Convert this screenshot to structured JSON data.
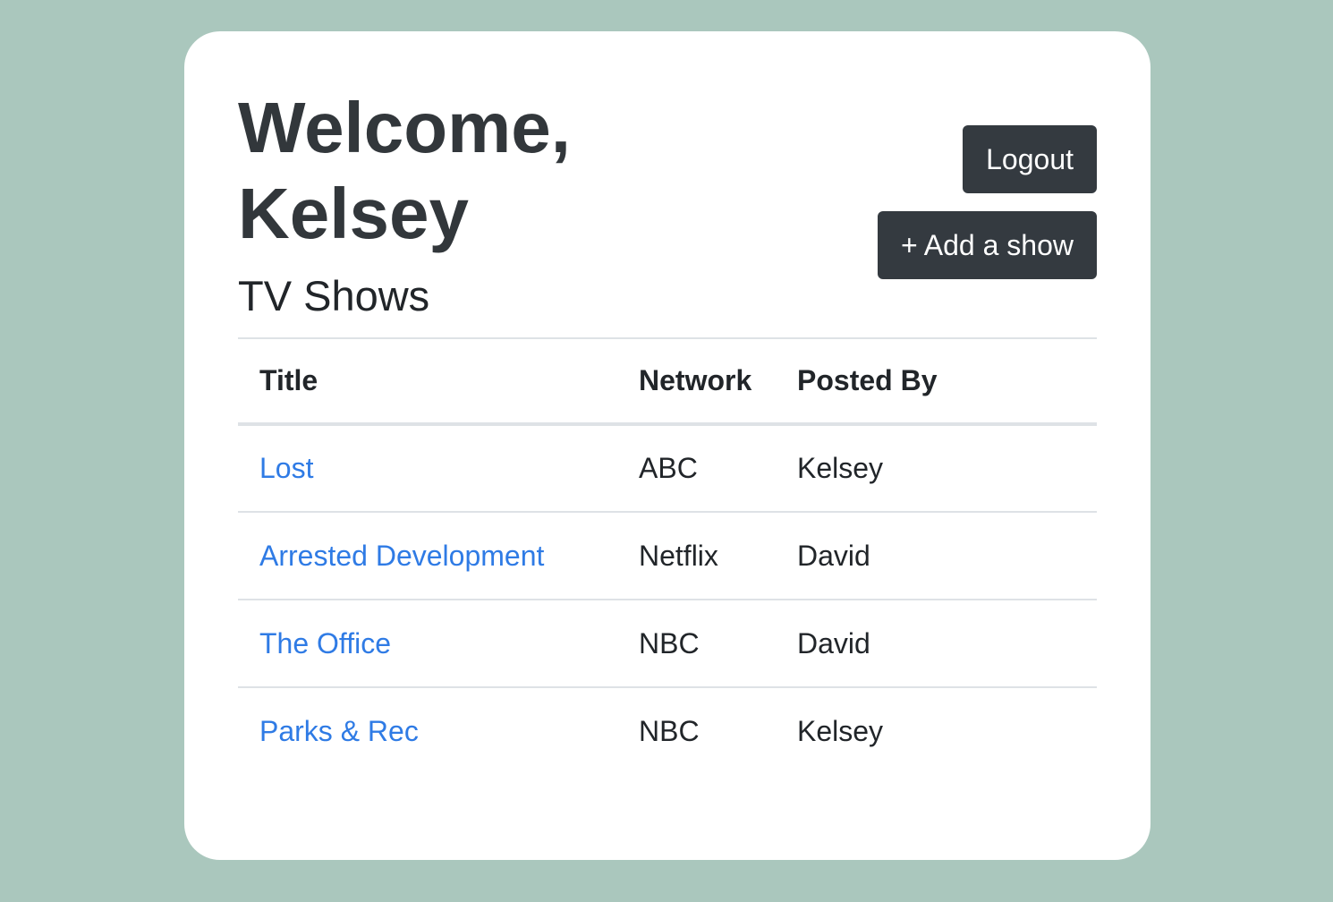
{
  "header": {
    "welcome_line1": "Welcome,",
    "welcome_line2": "Kelsey",
    "subtitle": "TV Shows"
  },
  "actions": {
    "logout_label": "Logout",
    "add_show_label": "+ Add a show"
  },
  "table": {
    "columns": [
      "Title",
      "Network",
      "Posted By"
    ],
    "rows": [
      {
        "title": "Lost",
        "network": "ABC",
        "posted_by": "Kelsey"
      },
      {
        "title": "Arrested Development",
        "network": "Netflix",
        "posted_by": "David"
      },
      {
        "title": "The Office",
        "network": "NBC",
        "posted_by": "David"
      },
      {
        "title": "Parks & Rec",
        "network": "NBC",
        "posted_by": "Kelsey"
      }
    ]
  },
  "colors": {
    "background": "#aac7bd",
    "card": "#ffffff",
    "button": "#343a40",
    "link": "#2f7be5",
    "heading": "#32373b"
  }
}
